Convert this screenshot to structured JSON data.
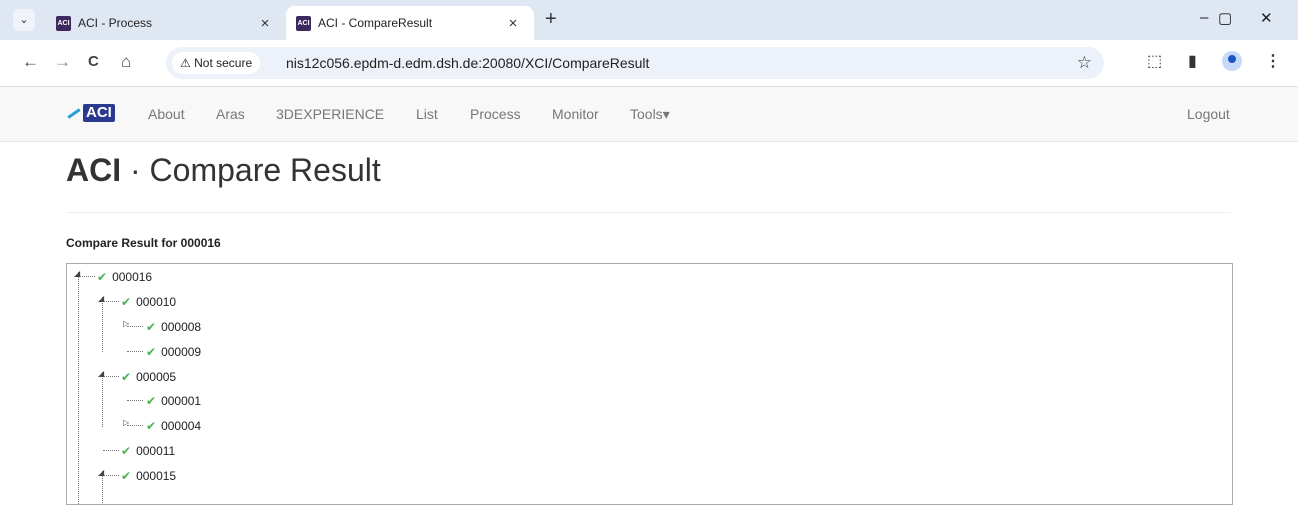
{
  "browser": {
    "tabs": [
      {
        "favicon": "ACI",
        "title": "ACI - Process",
        "close": "×"
      },
      {
        "favicon": "ACI",
        "title": "ACI - CompareResult",
        "close": "×"
      }
    ],
    "new_tab": "+",
    "tab_search": "⌄",
    "window": {
      "minimize": "–",
      "maximize": "▢",
      "close": "✕"
    },
    "nav": {
      "back": "←",
      "forward": "→",
      "reload": "C",
      "home": "⌂"
    },
    "security_label": "Not secure",
    "url": "nis12c056.epdm-d.edm.dsh.de:20080/XCI/CompareResult",
    "bookmark": "☆",
    "extensions": "⬚",
    "sidepanel": "▮",
    "menu": "⋮"
  },
  "site": {
    "logo_text": "ACI",
    "nav": [
      "About",
      "Aras",
      "3DEXPERIENCE",
      "List",
      "Process",
      "Monitor",
      "Tools"
    ],
    "tools_caret": "▾",
    "logout": "Logout"
  },
  "page": {
    "title_bold": "ACI",
    "title_rest": " · Compare Result",
    "subtitle": "Compare Result for 000016"
  },
  "tree": [
    {
      "id": "000016",
      "status": "ok"
    },
    {
      "id": "000010",
      "status": "ok"
    },
    {
      "id": "000008",
      "status": "ok"
    },
    {
      "id": "000009",
      "status": "ok"
    },
    {
      "id": "000005",
      "status": "ok"
    },
    {
      "id": "000001",
      "status": "ok"
    },
    {
      "id": "000004",
      "status": "ok"
    },
    {
      "id": "000011",
      "status": "ok"
    },
    {
      "id": "000015",
      "status": "ok"
    }
  ],
  "colors": {
    "check": "#4caf50",
    "logo": "#2a3a8f",
    "tabstrip": "#dfe7f3"
  }
}
